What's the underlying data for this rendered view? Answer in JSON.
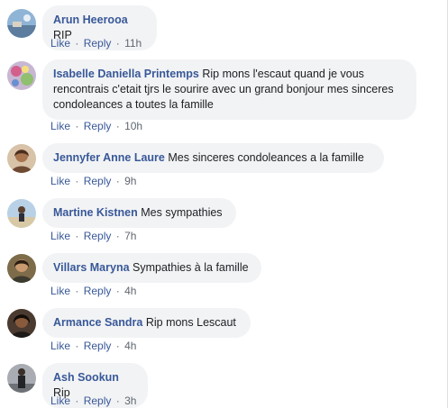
{
  "comments": [
    {
      "author": "Arun Heerooa",
      "text": "RIP",
      "like": "Like",
      "reply": "Reply",
      "time": "11h",
      "avatar_icon": "landscape-avatar",
      "avatar_color": "#7fa6c9"
    },
    {
      "author": "Isabelle Daniella Printemps",
      "text": "Rip mons l'escaut quand je vous rencontrais c'etait tjrs le sourire avec un grand bonjour mes sinceres condoleances a toutes la famille",
      "like": "Like",
      "reply": "Reply",
      "time": "10h",
      "avatar_icon": "floral-avatar",
      "avatar_color": "#b9a7c7"
    },
    {
      "author": "Jennyfer Anne Laure",
      "text": "Mes sinceres condoleances a la famille",
      "like": "Like",
      "reply": "Reply",
      "time": "9h",
      "avatar_icon": "person-avatar",
      "avatar_color": "#c9a07a"
    },
    {
      "author": "Martine Kistnen",
      "text": "Mes sympathies",
      "like": "Like",
      "reply": "Reply",
      "time": "7h",
      "avatar_icon": "beach-avatar",
      "avatar_color": "#a9c4dd"
    },
    {
      "author": "Villars Maryna",
      "text": "Sympathies à la famille",
      "like": "Like",
      "reply": "Reply",
      "time": "4h",
      "avatar_icon": "person-avatar",
      "avatar_color": "#6b5a3e"
    },
    {
      "author": "Armance Sandra",
      "text": "Rip mons Lescaut",
      "like": "Like",
      "reply": "Reply",
      "time": "4h",
      "avatar_icon": "person-avatar",
      "avatar_color": "#3b2a20"
    },
    {
      "author": "Ash Sookun",
      "text": "Rip",
      "like": "Like",
      "reply": "Reply",
      "time": "3h",
      "avatar_icon": "person-standing-avatar",
      "avatar_color": "#8b8f95"
    }
  ]
}
